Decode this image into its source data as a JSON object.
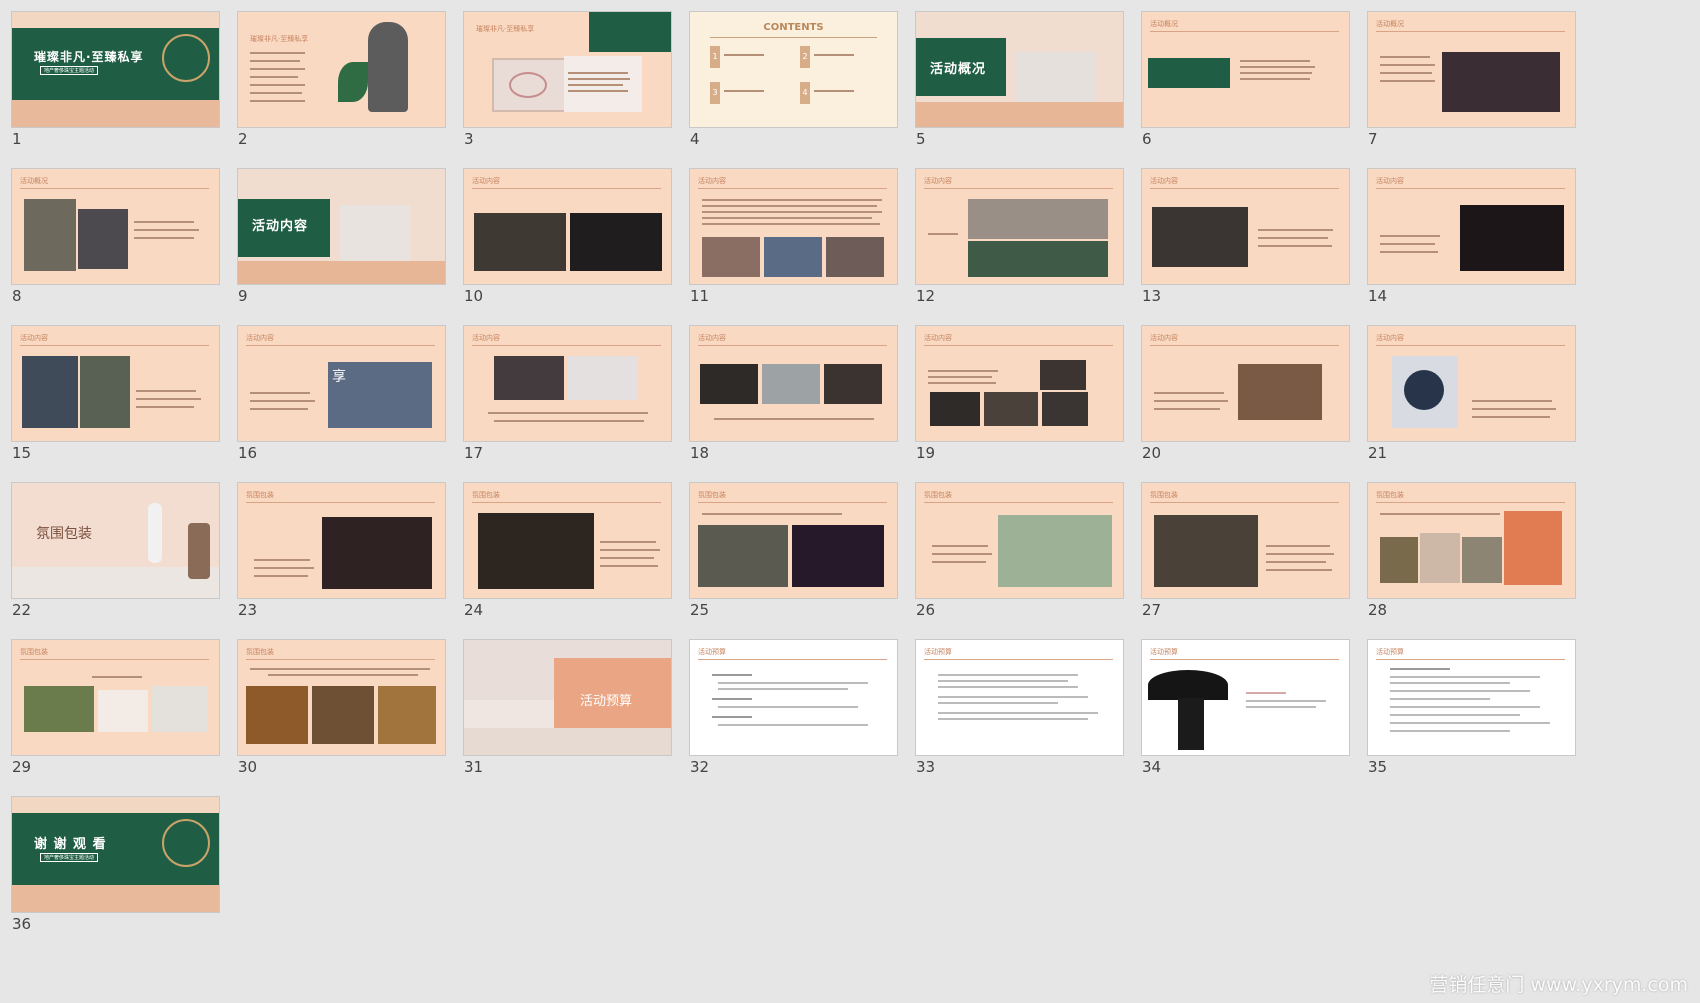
{
  "slides": [
    {
      "number": "1",
      "title": "璀璨非凡·至臻私享",
      "subtitle": "地产奢侈珠宝主题活动"
    },
    {
      "number": "2",
      "title": "璀璨非凡·至臻私享"
    },
    {
      "number": "3",
      "title": "璀璨非凡·至臻私享"
    },
    {
      "number": "4",
      "title": "CONTENTS",
      "items": [
        "1",
        "2",
        "3",
        "4"
      ]
    },
    {
      "number": "5",
      "title": "活动概况"
    },
    {
      "number": "6",
      "title": "活动概况"
    },
    {
      "number": "7",
      "title": "活动概况"
    },
    {
      "number": "8",
      "title": "活动概况"
    },
    {
      "number": "9",
      "title": "活动内容"
    },
    {
      "number": "10",
      "title": "活动内容"
    },
    {
      "number": "11",
      "title": "活动内容"
    },
    {
      "number": "12",
      "title": "活动内容"
    },
    {
      "number": "13",
      "title": "活动内容"
    },
    {
      "number": "14",
      "title": "活动内容"
    },
    {
      "number": "15",
      "title": "活动内容"
    },
    {
      "number": "16",
      "title": "活动内容",
      "badge": "享"
    },
    {
      "number": "17",
      "title": "活动内容"
    },
    {
      "number": "18",
      "title": "活动内容"
    },
    {
      "number": "19",
      "title": "活动内容"
    },
    {
      "number": "20",
      "title": "活动内容"
    },
    {
      "number": "21",
      "title": "活动内容"
    },
    {
      "number": "22",
      "title": "氛围包装"
    },
    {
      "number": "23",
      "title": "氛围包装"
    },
    {
      "number": "24",
      "title": "氛围包装"
    },
    {
      "number": "25",
      "title": "氛围包装"
    },
    {
      "number": "26",
      "title": "氛围包装"
    },
    {
      "number": "27",
      "title": "氛围包装"
    },
    {
      "number": "28",
      "title": "氛围包装"
    },
    {
      "number": "29",
      "title": "氛围包装"
    },
    {
      "number": "30",
      "title": "氛围包装"
    },
    {
      "number": "31",
      "title": "活动预算"
    },
    {
      "number": "32",
      "title": "活动预算"
    },
    {
      "number": "33",
      "title": "活动预算"
    },
    {
      "number": "34",
      "title": "活动预算"
    },
    {
      "number": "35",
      "title": "活动预算"
    },
    {
      "number": "36",
      "title": "谢 谢 观 看",
      "subtitle": "地产奢侈珠宝主题活动"
    }
  ],
  "watermark": "营销任意门 www.yxrym.com",
  "colors": {
    "background": "#e6e6e6",
    "slide_peach": "#f9d9c2",
    "accent_green": "#1f5d45",
    "header_copper": "#c7835f"
  }
}
